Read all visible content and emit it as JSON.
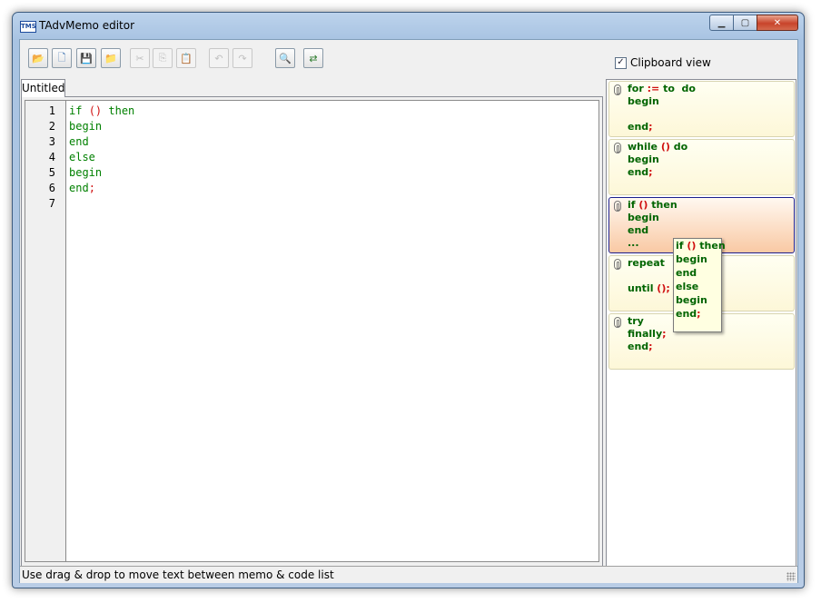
{
  "window": {
    "title": "TAdvMemo editor",
    "icon": "TMS"
  },
  "title_buttons": {
    "minimize": "minimize-icon",
    "maximize": "maximize-icon",
    "close": "close-icon"
  },
  "toolbar": {
    "buttons": [
      {
        "name": "open-file-button",
        "icon": "open-folder-icon",
        "enabled": true
      },
      {
        "name": "new-file-button",
        "icon": "new-document-icon",
        "enabled": true
      },
      {
        "name": "save-button",
        "icon": "floppy-disk-icon",
        "enabled": true
      },
      {
        "name": "save-as-button",
        "icon": "folder-save-icon",
        "enabled": true
      },
      {
        "name": "cut-button",
        "icon": "scissors-icon",
        "enabled": false
      },
      {
        "name": "copy-button",
        "icon": "copy-icon",
        "enabled": false
      },
      {
        "name": "paste-button",
        "icon": "paste-icon",
        "enabled": false
      },
      {
        "name": "undo-button",
        "icon": "undo-icon",
        "enabled": false
      },
      {
        "name": "redo-button",
        "icon": "redo-icon",
        "enabled": false
      },
      {
        "name": "find-button",
        "icon": "magnifier-icon",
        "enabled": true
      },
      {
        "name": "replace-button",
        "icon": "find-replace-icon",
        "enabled": true
      }
    ],
    "clipboard_view_label": "Clipboard view",
    "clipboard_view_checked": true
  },
  "tabs": [
    {
      "label": "Untitled",
      "active": true
    }
  ],
  "memo": {
    "lines": [
      {
        "num": "1",
        "text": "if () then"
      },
      {
        "num": "2",
        "text": "begin"
      },
      {
        "num": "3",
        "text": "end"
      },
      {
        "num": "4",
        "text": "else"
      },
      {
        "num": "5",
        "text": "begin"
      },
      {
        "num": "6",
        "text": "end;"
      },
      {
        "num": "7",
        "text": ""
      }
    ]
  },
  "code_list": [
    {
      "text": "for := to  do\nbegin\n\nend;",
      "selected": false
    },
    {
      "text": "while () do\nbegin\nend;",
      "selected": false
    },
    {
      "text": "if () then\nbegin\nend\n...",
      "selected": true
    },
    {
      "text": "repeat\n\nuntil ();",
      "selected": false
    },
    {
      "text": "try\nfinally;\nend;",
      "selected": false
    }
  ],
  "tooltip": {
    "text": "if () then\nbegin\nend\nelse\nbegin\nend;"
  },
  "status": {
    "text": "Use drag & drop to move text between memo & code list"
  },
  "colors": {
    "keyword": "#008000",
    "symbol": "#d01010",
    "selection": "#f9c9a4"
  }
}
